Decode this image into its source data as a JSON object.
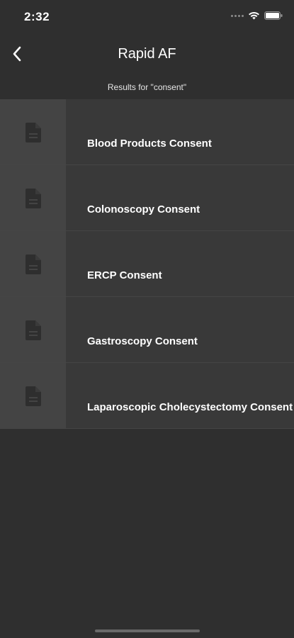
{
  "status_bar": {
    "time": "2:32"
  },
  "nav": {
    "title": "Rapid AF",
    "back_icon": "chevron-left-icon"
  },
  "search": {
    "results_label": "Results for \"consent\""
  },
  "results": [
    {
      "label": "Blood Products Consent",
      "icon": "document-icon"
    },
    {
      "label": "Colonoscopy Consent",
      "icon": "document-icon"
    },
    {
      "label": "ERCP Consent",
      "icon": "document-icon"
    },
    {
      "label": "Gastroscopy Consent",
      "icon": "document-icon"
    },
    {
      "label": "Laparoscopic Cholecystectomy Consent",
      "icon": "document-icon"
    }
  ],
  "colors": {
    "background": "#2f2f2f",
    "row_background": "#393939",
    "thumb_background": "#444444",
    "text": "#ffffff"
  }
}
